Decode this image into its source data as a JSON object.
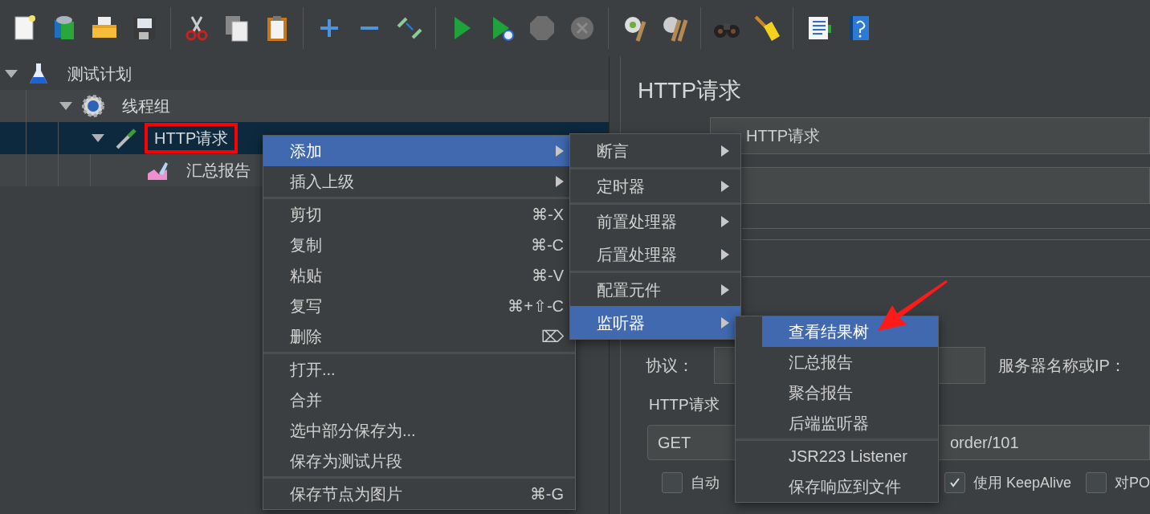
{
  "tree": [
    {
      "label": "测试计划",
      "kind": "flask",
      "expanded": true,
      "selected": false,
      "highlighted": false,
      "children": [
        {
          "label": "线程组",
          "kind": "gear",
          "expanded": true,
          "selected": false,
          "highlighted": false,
          "children": [
            {
              "label": "HTTP请求",
              "kind": "pipette",
              "expanded": true,
              "selected": true,
              "highlighted": true,
              "children": [
                {
                  "label": "汇总报告",
                  "kind": "chart",
                  "selected": false,
                  "highlighted": false
                }
              ]
            }
          ]
        }
      ]
    }
  ],
  "editor": {
    "title": "HTTP请求",
    "name_value": "HTTP请求",
    "protocol_label": "协议：",
    "server_label": "服务器名称或IP：",
    "section_legend": "HTTP请求",
    "method": "GET",
    "path_value": "order/101",
    "checkboxes": [
      {
        "label": "自动",
        "checked": false
      },
      {
        "label": "使用 KeepAlive",
        "checked": true
      },
      {
        "label": "对PO",
        "checked": false
      }
    ]
  },
  "context_menu": {
    "groups": [
      [
        {
          "label": "添加",
          "submenu": true,
          "selected": true
        },
        {
          "label": "插入上级",
          "submenu": true,
          "selected": false
        }
      ],
      [
        {
          "label": "剪切",
          "shortcut": "⌘-X",
          "selected": false
        },
        {
          "label": "复制",
          "shortcut": "⌘-C",
          "selected": false
        },
        {
          "label": "粘贴",
          "shortcut": "⌘-V",
          "selected": false
        },
        {
          "label": "复写",
          "shortcut": "⌘+⇧-C",
          "selected": false
        },
        {
          "label": "删除",
          "shortcut": "⌦",
          "selected": false
        }
      ],
      [
        {
          "label": "打开...",
          "selected": false
        },
        {
          "label": "合并",
          "selected": false
        },
        {
          "label": "选中部分保存为...",
          "selected": false
        },
        {
          "label": "保存为测试片段",
          "selected": false
        }
      ],
      [
        {
          "label": "保存节点为图片",
          "shortcut": "⌘-G",
          "selected": false
        }
      ]
    ]
  },
  "add_submenu": {
    "groups": [
      [
        {
          "label": "断言",
          "submenu": true,
          "selected": false
        }
      ],
      [
        {
          "label": "定时器",
          "submenu": true,
          "selected": false
        }
      ],
      [
        {
          "label": "前置处理器",
          "submenu": true,
          "selected": false
        },
        {
          "label": "后置处理器",
          "submenu": true,
          "selected": false
        }
      ],
      [
        {
          "label": "配置元件",
          "submenu": true,
          "selected": false
        },
        {
          "label": "监听器",
          "submenu": true,
          "selected": true
        }
      ]
    ]
  },
  "listener_submenu": {
    "groups": [
      [
        {
          "label": "查看结果树",
          "selected": true
        },
        {
          "label": "汇总报告",
          "selected": false
        },
        {
          "label": "聚合报告",
          "selected": false
        },
        {
          "label": "后端监听器",
          "selected": false
        }
      ],
      [
        {
          "label": "JSR223 Listener",
          "selected": false
        },
        {
          "label": "保存响应到文件",
          "selected": false
        }
      ]
    ]
  }
}
